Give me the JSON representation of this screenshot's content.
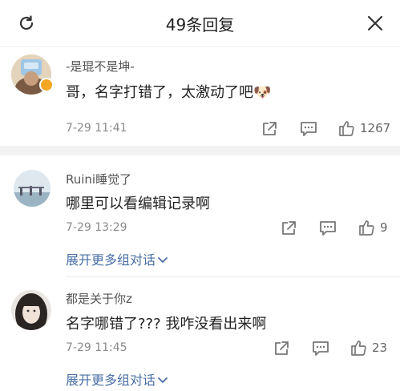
{
  "header": {
    "title": "49条回复",
    "refresh_icon": "refresh-icon",
    "close_icon": "close-icon"
  },
  "main_comment": {
    "username": "-是琨不是坤-",
    "text": "哥，名字打错了，太激动了吧",
    "emoji": "🐶",
    "time": "7-29 11:41",
    "like_count": "1267"
  },
  "replies": [
    {
      "username": "Ruini睡觉了",
      "text": "哪里可以看编辑记录啊",
      "time": "7-29 13:29",
      "like_count": "9",
      "more_label": "展开更多组对话"
    },
    {
      "username": "都是关于你z",
      "text": "名字哪错了??? 我咋没看出来啊",
      "time": "7-29 11:45",
      "like_count": "23",
      "more_label": "展开更多组对话"
    }
  ],
  "colors": {
    "link": "#4b6fa5",
    "divider": "#f2f2f2",
    "verified_badge": "#f5a623"
  }
}
